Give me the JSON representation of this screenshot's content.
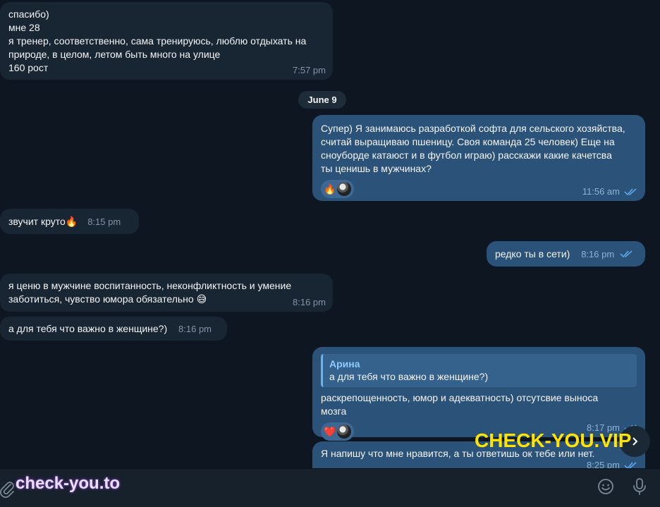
{
  "messages": {
    "m1": {
      "lines": [
        "спасибо)",
        "мне 28",
        "я тренер, соответственно, сама тренируюсь, люблю отдыхать на",
        "природе, в целом, летом быть много на улице",
        "160 рост"
      ],
      "time": "7:57 pm"
    },
    "date_divider": "June 9",
    "m2": {
      "lines": [
        "Супер) Я занимаюсь разработкой софта для сельского хозяйства,",
        "считай выращиваю пшеницу. Своя команда 25 человек) Еще на",
        "сноуборде катаюст и в футбол играю) расскажи какие качетсва",
        "ты ценишь в мужчинах?"
      ],
      "time": "11:56 am",
      "reaction_emoji": "🔥"
    },
    "m3": {
      "text": "звучит круто",
      "emoji": "🔥",
      "time": "8:15 pm"
    },
    "m4": {
      "text": "редко ты в сети)",
      "time": "8:16 pm"
    },
    "m5": {
      "lines": [
        "я ценю в мужчине воспитанность, неконфликтность и умение",
        "заботиться, чувство юмора обязательно"
      ],
      "emoji": "😅",
      "time": "8:16 pm"
    },
    "m6": {
      "text": "а для тебя что важно в женщине?)",
      "time": "8:16 pm"
    },
    "m7": {
      "reply_name": "Арина",
      "reply_text": "а для тебя что важно в женщине?)",
      "lines": [
        "раскрепощенность, юмор и адекватность) отсутсвие выноса",
        "мозга"
      ],
      "time": "8:17 pm",
      "reaction_emoji": "❤️"
    },
    "m8": {
      "text": "Я напишу что мне нравится, а ты ответишь ок тебе или нет.",
      "time": "8:25 pm"
    }
  },
  "watermark": "CHECK-YOU.VIP",
  "composer": {
    "placeholder": "",
    "brand": "check-you.to"
  },
  "colors": {
    "background": "#0e1621",
    "incoming": "#182533",
    "outgoing": "#2b5278",
    "watermark": "#ffe400"
  }
}
